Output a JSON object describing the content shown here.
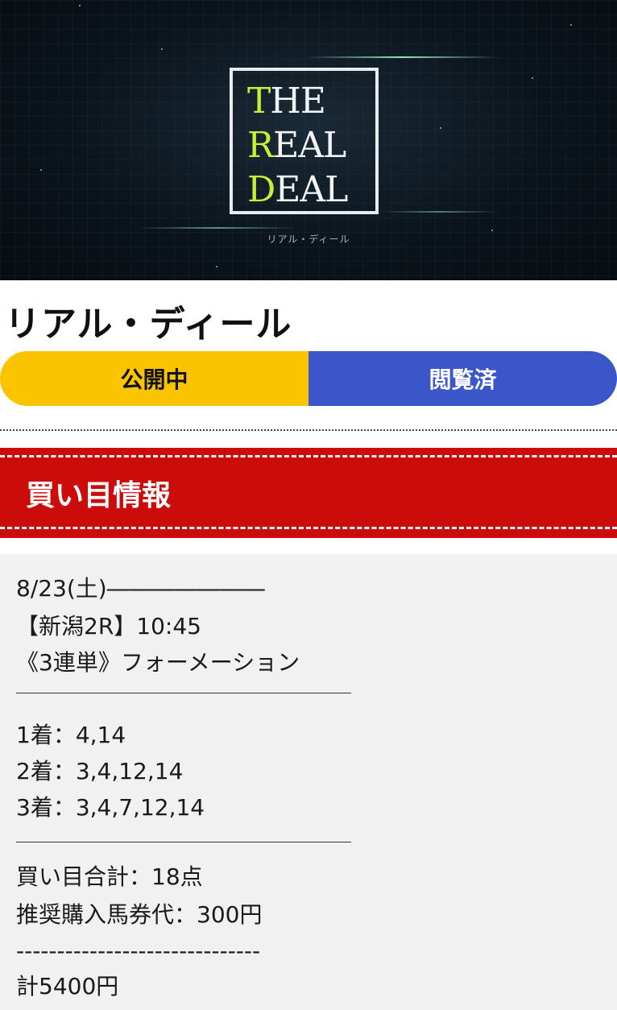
{
  "hero": {
    "logo_words": [
      "THE",
      "REAL",
      "DEAL"
    ],
    "logo_subtitle": "リアル・ディール",
    "accent_color": "#c8ee3a"
  },
  "page_title": "リアル・ディール",
  "status": {
    "public_label": "公開中",
    "viewed_label": "閲覧済",
    "public_color": "#fbc400",
    "viewed_color": "#3b56c8"
  },
  "section": {
    "title": "買い目情報",
    "color": "#cc0b0b"
  },
  "info": {
    "date": "8/23(土)―――――――",
    "race": "【新潟2R】10:45",
    "bet_type": "《3連単》フォーメーション",
    "first": "1着：4,14",
    "second": "2着：3,4,12,14",
    "third": "3着：3,4,7,12,14",
    "total_points": "買い目合計：18点",
    "recommended": "推奨購入馬券代：300円",
    "dash_line": "------------------------------",
    "total": "計5400円"
  }
}
